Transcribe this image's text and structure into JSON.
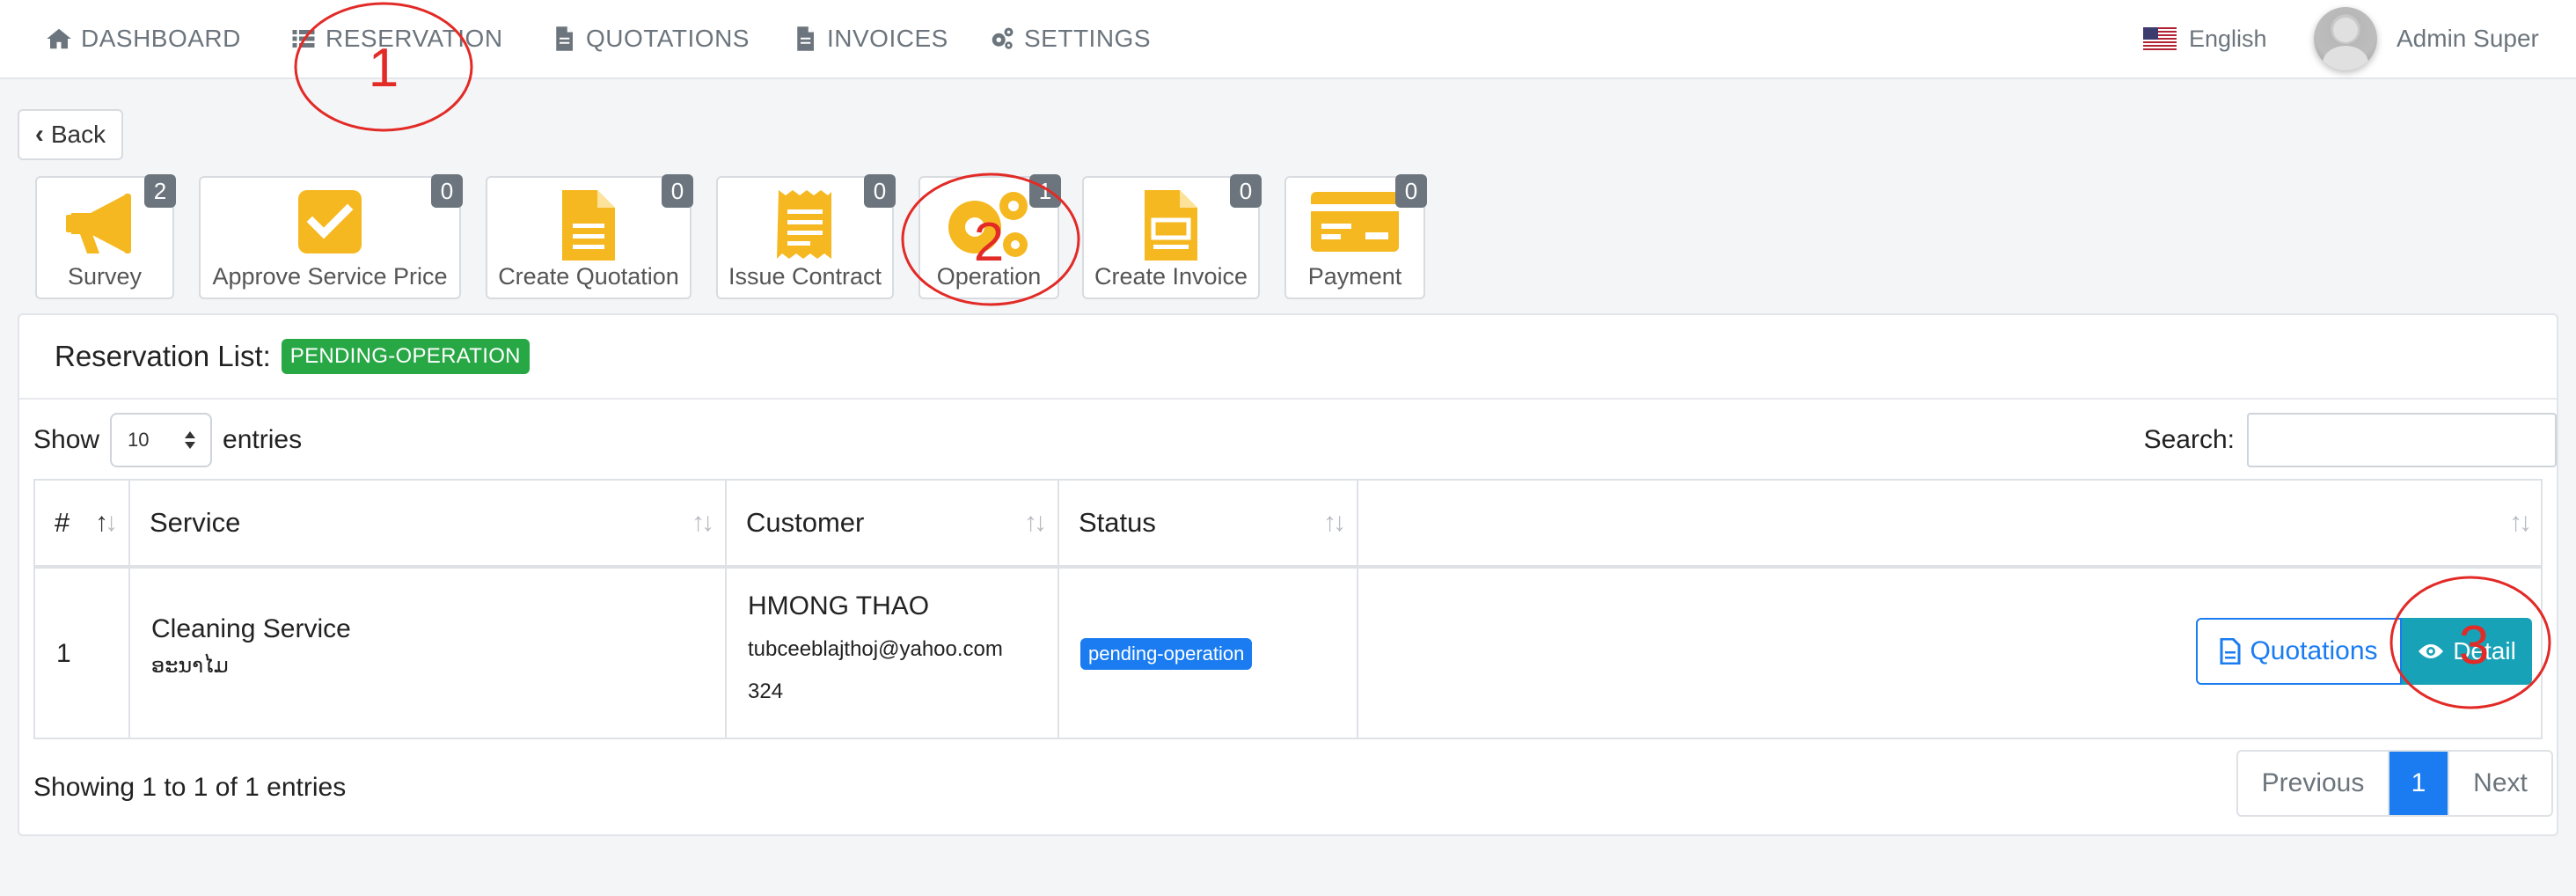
{
  "nav": {
    "items": [
      {
        "label": "DASHBOARD",
        "icon": "home-icon"
      },
      {
        "label": "RESERVATION",
        "icon": "list-icon"
      },
      {
        "label": "QUOTATIONS",
        "icon": "file-icon"
      },
      {
        "label": "INVOICES",
        "icon": "file-icon"
      },
      {
        "label": "SETTINGS",
        "icon": "gears-icon"
      }
    ],
    "language": "English",
    "user_name": "Admin Super"
  },
  "back_label": "Back",
  "steps": [
    {
      "label": "Survey",
      "count": "2",
      "icon": "megaphone-icon"
    },
    {
      "label": "Approve Service Price",
      "count": "0",
      "icon": "check-icon"
    },
    {
      "label": "Create Quotation",
      "count": "0",
      "icon": "file-icon"
    },
    {
      "label": "Issue Contract",
      "count": "0",
      "icon": "receipt-icon"
    },
    {
      "label": "Operation",
      "count": "1",
      "icon": "gears-icon"
    },
    {
      "label": "Create Invoice",
      "count": "0",
      "icon": "invoice-icon"
    },
    {
      "label": "Payment",
      "count": "0",
      "icon": "card-icon"
    }
  ],
  "card": {
    "title": "Reservation List:",
    "status": "PENDING-OPERATION",
    "show_label": "Show",
    "page_size": "10",
    "entries_label": "entries",
    "search_label": "Search:",
    "search_value": ""
  },
  "table": {
    "columns": [
      "#",
      "Service",
      "Customer",
      "Status",
      ""
    ],
    "rows": [
      {
        "index": "1",
        "service": "Cleaning Service",
        "service_sub": "ອະນາໄມ",
        "customer": "HMONG THAO",
        "email": "tubceeblajthoj@yahoo.com",
        "phone": "324",
        "status": "pending-operation",
        "quotations_label": "Quotations",
        "detail_label": "Detail"
      }
    ]
  },
  "summary": "Showing 1 to 1 of 1 entries",
  "pager": {
    "prev": "Previous",
    "current": "1",
    "next": "Next"
  },
  "annotations": [
    "1",
    "2",
    "3"
  ],
  "colors": {
    "accent": "#1a7cf0",
    "success": "#28a745",
    "info": "#17a2b8",
    "icon_yellow": "#f5b820",
    "annotation": "#e22a26"
  }
}
